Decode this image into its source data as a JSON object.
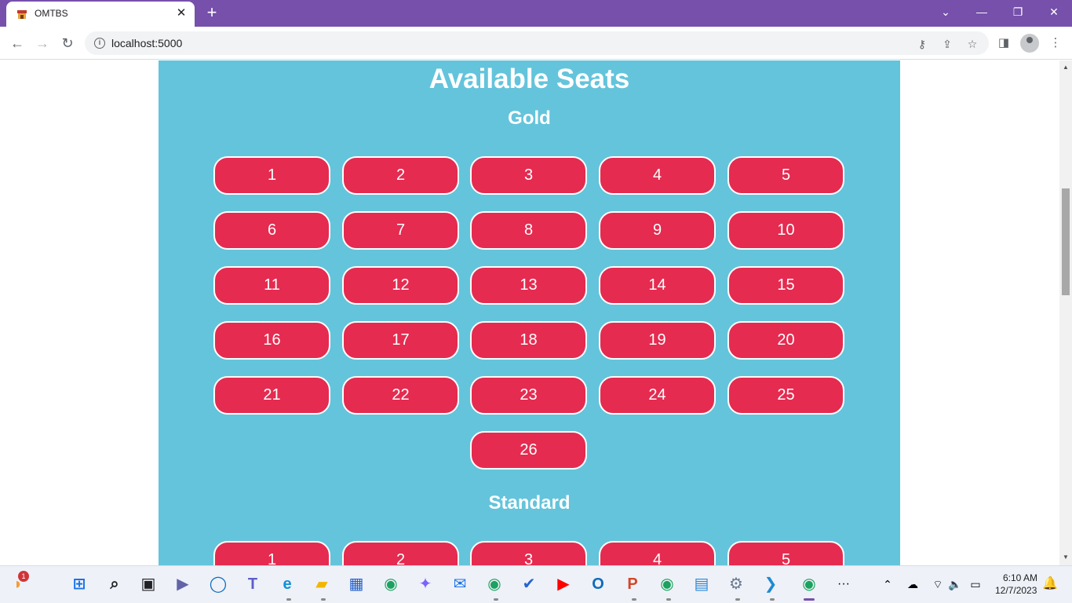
{
  "browser": {
    "tab_title": "OMTBS",
    "tab_close": "✕",
    "new_tab": "+",
    "url": "localhost:5000",
    "window_controls": {
      "collapse": "⌄",
      "minimize": "—",
      "restore": "❐",
      "close": "✕"
    }
  },
  "page": {
    "title": "Available Seats",
    "sections": [
      {
        "name": "Gold",
        "seats": [
          "1",
          "2",
          "3",
          "4",
          "5",
          "6",
          "7",
          "8",
          "9",
          "10",
          "11",
          "12",
          "13",
          "14",
          "15",
          "16",
          "17",
          "18",
          "19",
          "20",
          "21",
          "22",
          "23",
          "24",
          "25",
          "26"
        ]
      },
      {
        "name": "Standard",
        "seats": [
          "1",
          "2",
          "3",
          "4",
          "5"
        ]
      }
    ],
    "seat_color": "#e52b50",
    "panel_color": "#64c4db"
  },
  "taskbar": {
    "notification_badge": "1",
    "time": "6:10 AM",
    "date": "12/7/2023",
    "more_label": "···",
    "apps": [
      "start-icon",
      "search-icon",
      "task-view-icon",
      "zoom-icon",
      "cortana-icon",
      "teams-icon",
      "edge-icon",
      "file-explorer-icon",
      "store-icon",
      "chrome-icon",
      "copilot-icon",
      "mail-icon",
      "chrome-icon",
      "todo-icon",
      "youtube-icon",
      "outlook-icon",
      "powerpoint-icon",
      "chrome-icon",
      "notepad-icon",
      "settings-icon",
      "vscode-icon",
      "chrome-icon"
    ]
  }
}
